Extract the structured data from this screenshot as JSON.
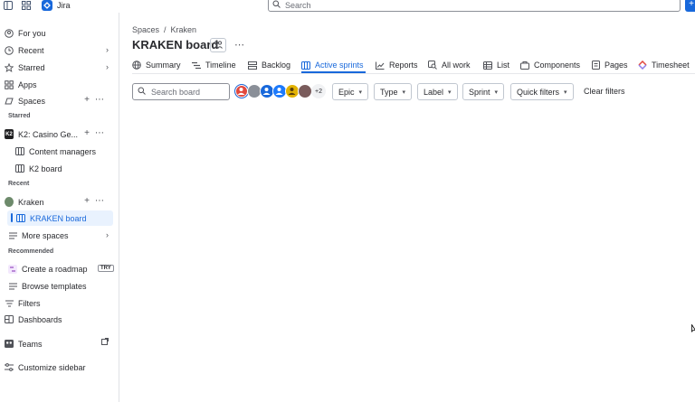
{
  "topbar": {
    "app_name": "Jira",
    "search_placeholder": "Search",
    "create_label": "+"
  },
  "sidebar": {
    "items": [
      {
        "label": "For you"
      },
      {
        "label": "Recent"
      },
      {
        "label": "Starred"
      },
      {
        "label": "Apps"
      },
      {
        "label": "Spaces"
      }
    ],
    "starred_section": "Starred",
    "starred": {
      "space": "K2: Casino Ge...",
      "space_icon_text": "K2",
      "children": [
        "Content managers",
        "K2 board"
      ]
    },
    "recent_section": "Recent",
    "recent": {
      "space": "Kraken",
      "board": "KRAKEN board",
      "more": "More spaces"
    },
    "recommended_section": "Recommended",
    "recommended": [
      {
        "label": "Create a roadmap",
        "badge": "TRY"
      },
      {
        "label": "Browse templates"
      }
    ],
    "bottom": [
      {
        "label": "Filters"
      },
      {
        "label": "Dashboards"
      },
      {
        "label": "Teams"
      },
      {
        "label": "Customize sidebar"
      }
    ]
  },
  "main": {
    "breadcrumb": [
      "Spaces",
      "Kraken"
    ],
    "breadcrumb_sep": "/",
    "title": "KRAKEN board",
    "tabs": [
      {
        "label": "Summary"
      },
      {
        "label": "Timeline"
      },
      {
        "label": "Backlog"
      },
      {
        "label": "Active sprints",
        "active": true
      },
      {
        "label": "Reports"
      },
      {
        "label": "All work"
      },
      {
        "label": "List"
      },
      {
        "label": "Components"
      },
      {
        "label": "Pages"
      },
      {
        "label": "Timesheet"
      }
    ],
    "board_search_placeholder": "Search board",
    "avatars_more": "+2",
    "filters": [
      "Epic",
      "Type",
      "Label",
      "Sprint",
      "Quick filters"
    ],
    "clear_filters": "Clear filters"
  },
  "colors": {
    "accent": "#1868db",
    "active_bg": "#e9f2fe"
  }
}
